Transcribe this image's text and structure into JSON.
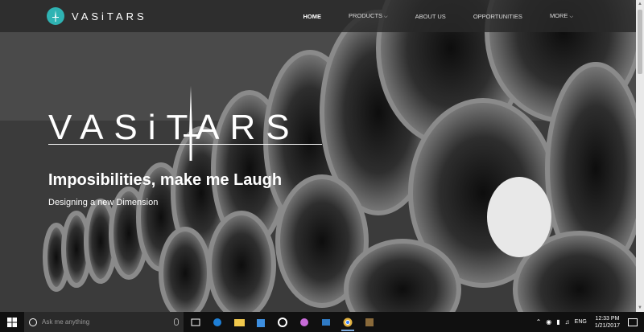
{
  "brand": {
    "logo_text": "VASiTARS"
  },
  "nav": {
    "items": [
      {
        "label": "HOME"
      },
      {
        "label": "PRODUCTS"
      },
      {
        "label": "ABOUT US"
      },
      {
        "label": "OPPORTUNITIES"
      },
      {
        "label": "MORE"
      }
    ]
  },
  "hero": {
    "logo_word": "VASiTARS",
    "title": "Imposibilities, make me Laugh",
    "subtitle": "Designing a new Dimension"
  },
  "taskbar": {
    "search_placeholder": "Ask me anything",
    "language": "ENG",
    "time": "12:33 PM",
    "date": "1/21/2017",
    "icons": [
      "task-view-icon",
      "edge-icon",
      "file-explorer-icon",
      "store-icon",
      "media-icon",
      "app-icon",
      "photos-icon",
      "chrome-icon",
      "app-icon-2"
    ]
  },
  "colors": {
    "accent": "#2fb3b3",
    "navbar_bg": "#282828"
  }
}
